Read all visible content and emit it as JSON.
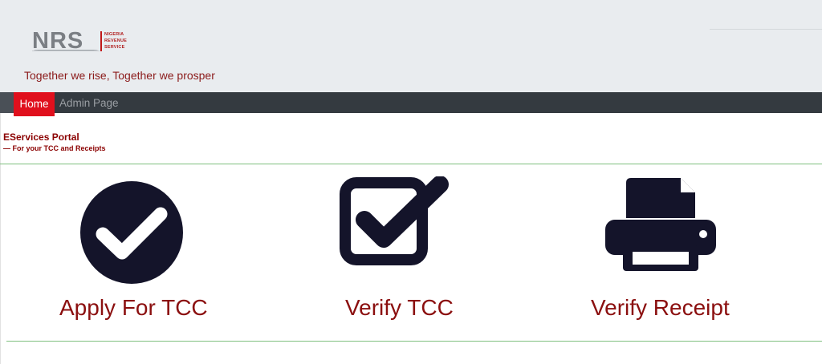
{
  "header": {
    "logo": {
      "abbr": "NRS",
      "line1": "NIGERIA",
      "line2": "REVENUE",
      "line3": "SERVICE"
    },
    "tagline": "Together we rise, Together we prosper"
  },
  "nav": {
    "items": [
      {
        "label": "Home",
        "active": true
      },
      {
        "label": "Admin Page",
        "active": false
      }
    ]
  },
  "portal": {
    "title": "EServices Portal",
    "subtitle": "— For your TCC and Receipts"
  },
  "tiles": [
    {
      "label": "Apply For TCC",
      "icon": "check-circle-icon"
    },
    {
      "label": "Verify TCC",
      "icon": "check-square-icon"
    },
    {
      "label": "Verify Receipt",
      "icon": "printer-icon"
    }
  ],
  "colors": {
    "brand_red": "#e0101d",
    "label_red": "#8b0f0f",
    "icon_dark": "#14142a",
    "navbar": "#343a40",
    "header_bg": "#e9ecef",
    "rule_green": "#7fbf7f"
  }
}
